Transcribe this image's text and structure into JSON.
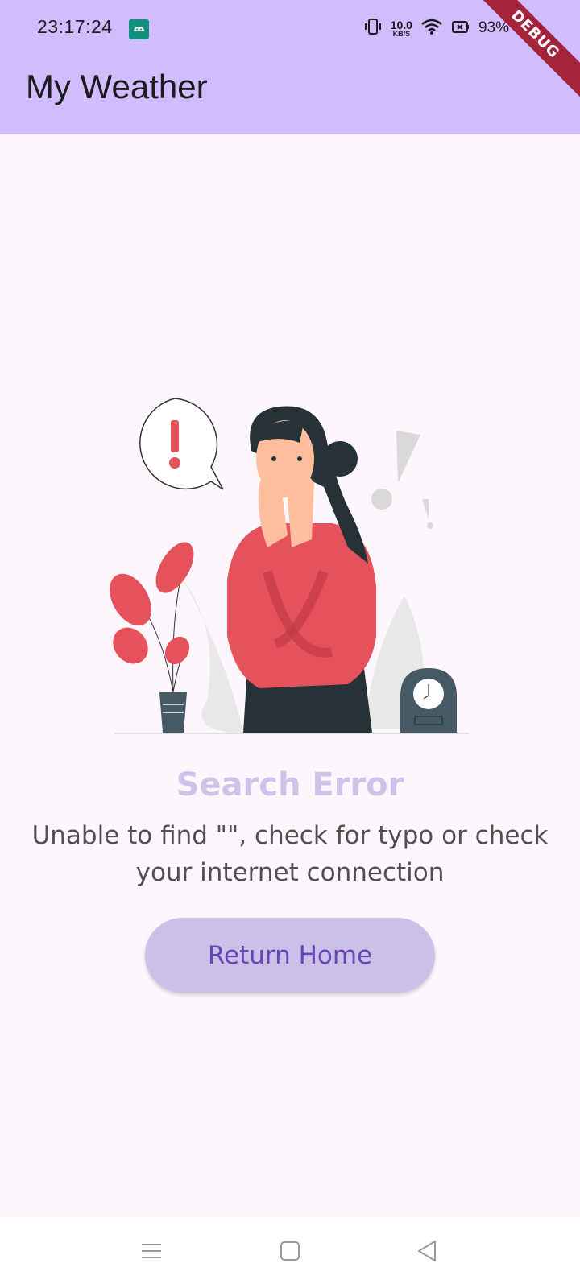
{
  "status_bar": {
    "time": "23:17:24",
    "net_speed_value": "10.0",
    "net_speed_unit": "KB/S",
    "battery": "93%"
  },
  "app_bar": {
    "title": "My Weather"
  },
  "debug_banner": "DEBUG",
  "error": {
    "title": "Search Error",
    "message": "Unable to find \"\", check for typo or check your internet connection"
  },
  "return_button": {
    "label": "Return Home"
  },
  "colors": {
    "app_bar": "#d1bcfd",
    "background": "#fdf7fd",
    "title": "#cfc3ea",
    "button_bg": "#cac0e8",
    "button_text": "#6844b7",
    "accent_red": "#e5525c"
  },
  "icons": [
    "android-notification-icon",
    "vibrate-icon",
    "wifi-icon",
    "battery-icon",
    "charging-icon",
    "menu-nav-icon",
    "home-nav-icon",
    "back-nav-icon"
  ]
}
